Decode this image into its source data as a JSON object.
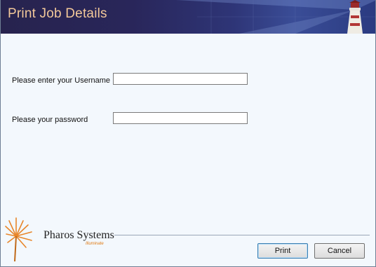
{
  "window": {
    "title": "Print Job Details"
  },
  "form": {
    "username_label": "Please enter your Username",
    "username_value": "",
    "password_label": "Please your password",
    "password_value": ""
  },
  "branding": {
    "name": "Pharos Systems",
    "tagline": "Illuminate"
  },
  "buttons": {
    "print": "Print",
    "cancel": "Cancel"
  }
}
